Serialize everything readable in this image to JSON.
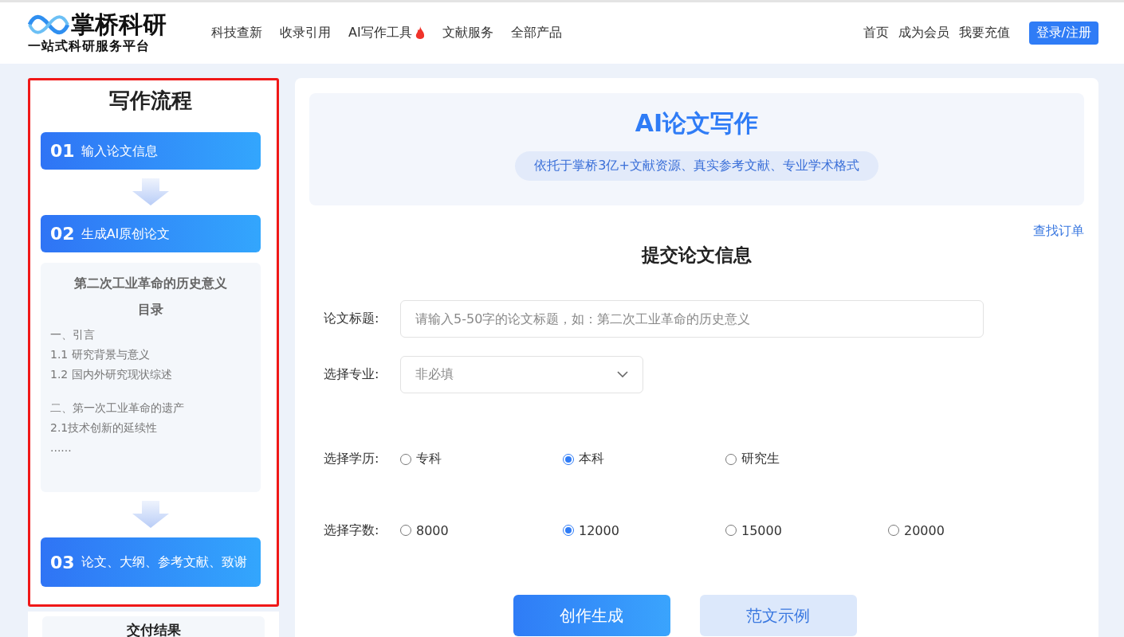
{
  "header": {
    "logo": {
      "name": "掌桥科研",
      "slogan": "一站式科研服务平台"
    },
    "nav": [
      {
        "label": "科技查新",
        "hot": false
      },
      {
        "label": "收录引用",
        "hot": false
      },
      {
        "label": "AI写作工具",
        "hot": true
      },
      {
        "label": "文献服务",
        "hot": false
      },
      {
        "label": "全部产品",
        "hot": false
      }
    ],
    "right_links": [
      "首页",
      "成为会员",
      "我要充值"
    ],
    "login_button": "登录/注册"
  },
  "sidebar": {
    "title": "写作流程",
    "annotation_frame": true,
    "flow": [
      {
        "kind": "step",
        "number": "01",
        "label": "输入论文信息"
      },
      {
        "kind": "arrow"
      },
      {
        "kind": "step",
        "number": "02",
        "label": "生成AI原创论文"
      },
      {
        "kind": "preview",
        "title": "第二次工业革命的历史意义",
        "toc_heading": "目录",
        "sections": [
          [
            "一、引言",
            "1.1 研究背景与意义",
            "1.2 国内外研究现状综述"
          ],
          [
            "二、第一次工业革命的遗产",
            "2.1技术创新的延续性",
            "......"
          ]
        ]
      },
      {
        "kind": "arrow"
      },
      {
        "kind": "step",
        "number": "03",
        "label": "论文、大纲、参考文献、致谢"
      }
    ],
    "delivery_title": "交付结果"
  },
  "main": {
    "hero": {
      "title": "AI论文写作",
      "subtitle": "依托于掌桥3亿+文献资源、真实参考文献、专业学术格式"
    },
    "find_order_link": "查找订单",
    "form_title": "提交论文信息",
    "fields": [
      {
        "kind": "text",
        "label": "论文标题:",
        "placeholder": "请输入5-50字的论文标题，如：第二次工业革命的历史意义"
      },
      {
        "kind": "select",
        "label": "选择专业:",
        "placeholder": "非必填"
      },
      {
        "kind": "radio",
        "label": "选择学历:",
        "options": [
          {
            "label": "专科",
            "selected": false
          },
          {
            "label": "本科",
            "selected": true
          },
          {
            "label": "研究生",
            "selected": false
          }
        ]
      },
      {
        "kind": "radio",
        "label": "选择字数:",
        "options": [
          {
            "label": "8000",
            "selected": false
          },
          {
            "label": "12000",
            "selected": true
          },
          {
            "label": "15000",
            "selected": false
          },
          {
            "label": "20000",
            "selected": false
          }
        ]
      }
    ],
    "buttons": [
      {
        "kind": "primary",
        "label": "创作生成"
      },
      {
        "kind": "secondary",
        "label": "范文示例"
      }
    ]
  }
}
